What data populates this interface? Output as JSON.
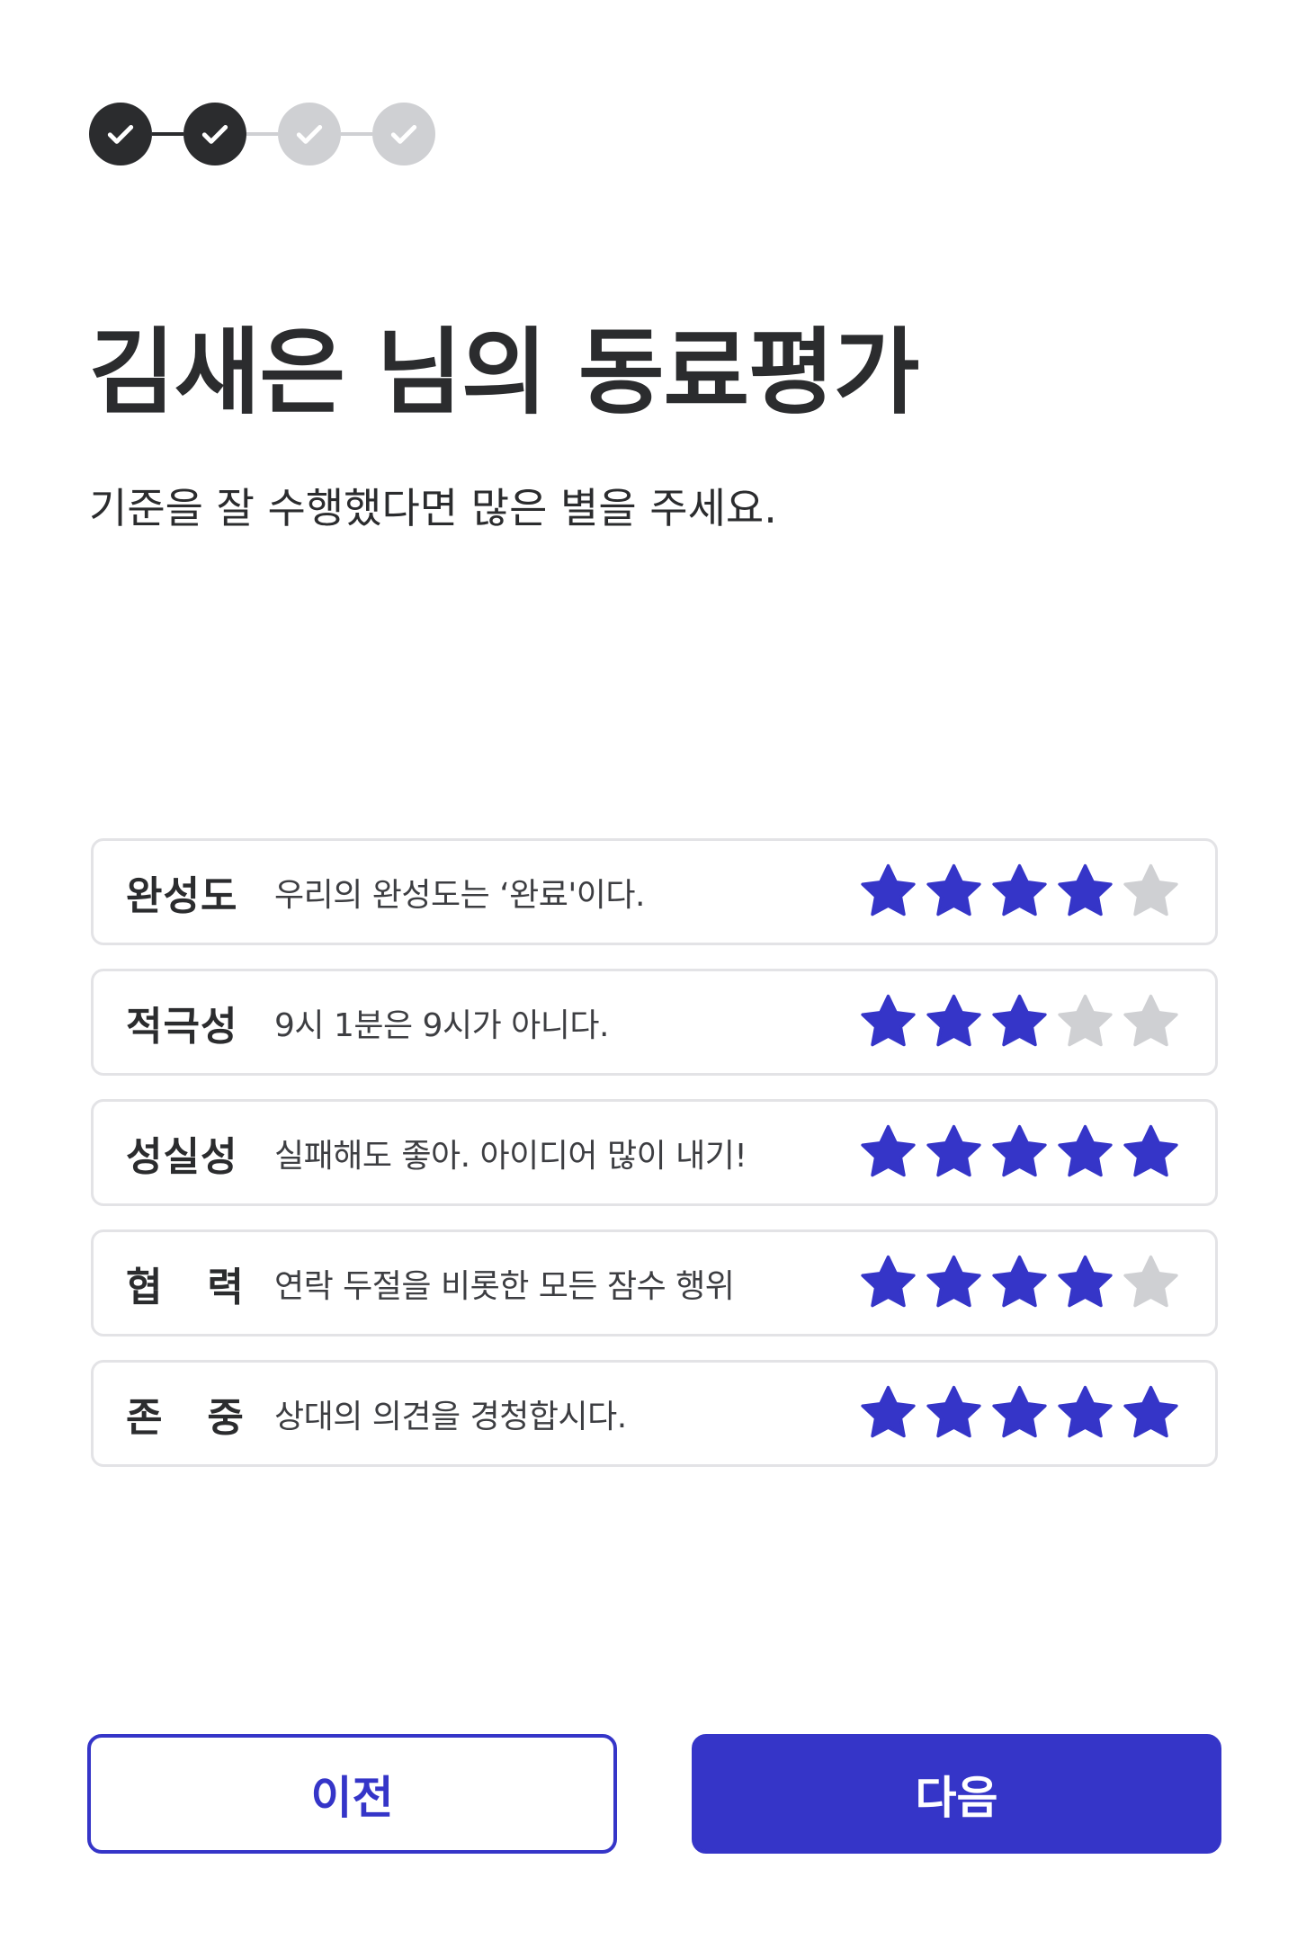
{
  "stepper": {
    "steps": [
      {
        "status": "done",
        "icon": "check-icon"
      },
      {
        "status": "done",
        "icon": "check-icon"
      },
      {
        "status": "todo",
        "icon": "check-icon"
      },
      {
        "status": "todo",
        "icon": "check-icon"
      }
    ],
    "colors": {
      "done": "#2b2c2e",
      "todo": "#cfd0d3"
    }
  },
  "header": {
    "title": "김새은 님의 동료평가",
    "subtitle": "기준을 잘 수행했다면 많은 별을 주세요."
  },
  "criteria": [
    {
      "name": "완성도",
      "description": "우리의 완성도는 ‘완료'이다.",
      "rating": 4,
      "max": 5
    },
    {
      "name": "적극성",
      "description": "9시 1분은 9시가 아니다.",
      "rating": 3,
      "max": 5
    },
    {
      "name": "성실성",
      "description": "실패해도 좋아. 아이디어 많이 내기!",
      "rating": 5,
      "max": 5
    },
    {
      "name": "협   력",
      "description": "연락 두절을 비롯한 모든 잠수 행위",
      "rating": 4,
      "max": 5
    },
    {
      "name": "존   중",
      "description": "상대의 의견을 경청합시다.",
      "rating": 5,
      "max": 5
    }
  ],
  "star_colors": {
    "filled": "#3535c8",
    "empty": "#cfd0d3"
  },
  "buttons": {
    "prev_label": "이전",
    "next_label": "다음"
  },
  "colors": {
    "accent": "#3535c8",
    "text": "#2b2c2e",
    "border": "#e3e3e6"
  }
}
